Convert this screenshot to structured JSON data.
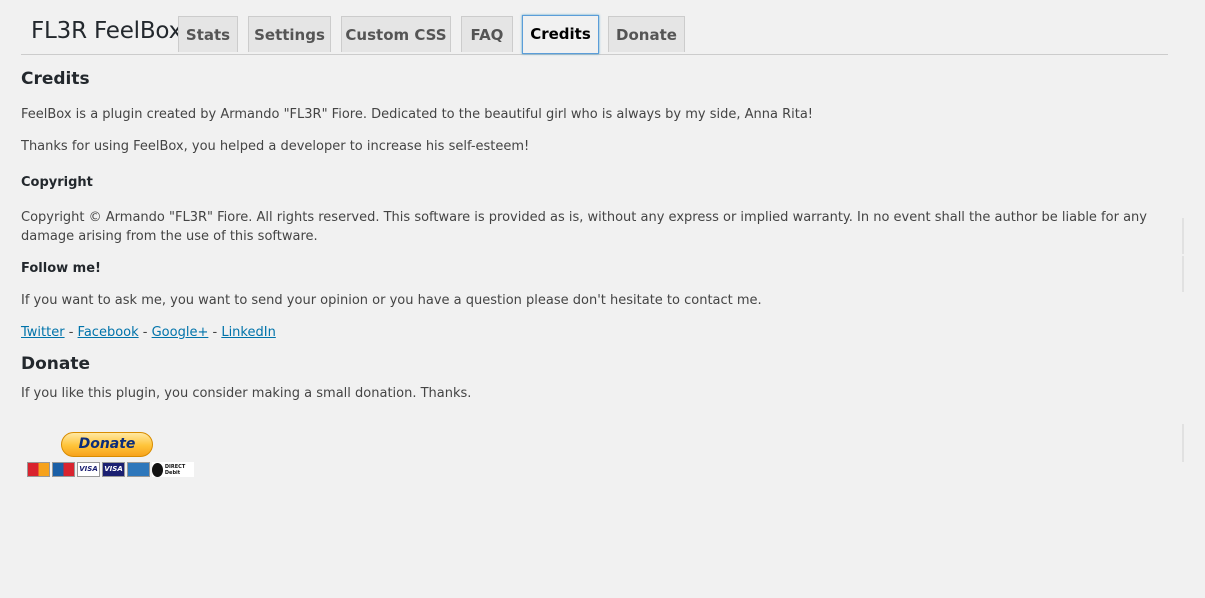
{
  "app": {
    "title": "FL3R FeelBox"
  },
  "tabs": [
    {
      "label": "Stats",
      "active": false
    },
    {
      "label": "Settings",
      "active": false
    },
    {
      "label": "Custom CSS",
      "active": false
    },
    {
      "label": "FAQ",
      "active": false
    },
    {
      "label": "Credits",
      "active": true
    },
    {
      "label": "Donate",
      "active": false
    }
  ],
  "credits": {
    "heading": "Credits",
    "line1": "FeelBox is a plugin created by Armando \"FL3R\" Fiore. Dedicated to the beautiful girl who is always by my side, Anna Rita!",
    "line2": "Thanks for using FeelBox, you helped a developer to increase his self-esteem!",
    "copyright_heading": "Copyright",
    "copyright_text": "Copyright © Armando \"FL3R\" Fiore. All rights reserved. This software is provided as is, without any express or implied warranty. In no event shall the author be liable for any damage arising from the use of this software.",
    "follow_heading": "Follow me!",
    "follow_text": "If you want to ask me, you want to send your opinion or you have a question please don't hesitate to contact me.",
    "links": [
      {
        "label": "Twitter"
      },
      {
        "label": "Facebook"
      },
      {
        "label": "Google+"
      },
      {
        "label": "LinkedIn"
      }
    ],
    "link_separator": " - "
  },
  "donate": {
    "heading": "Donate",
    "text": "If you like this plugin, you consider making a small donation. Thanks.",
    "button_label": "Donate",
    "card_labels": {
      "visa": "VISA"
    },
    "direct_debit_label": "DIRECT Debit"
  },
  "colors": {
    "background": "#f1f1f1",
    "link": "#0073aa",
    "active_tab_border": "#5b9dd9",
    "donate_button": "#ffc439"
  }
}
